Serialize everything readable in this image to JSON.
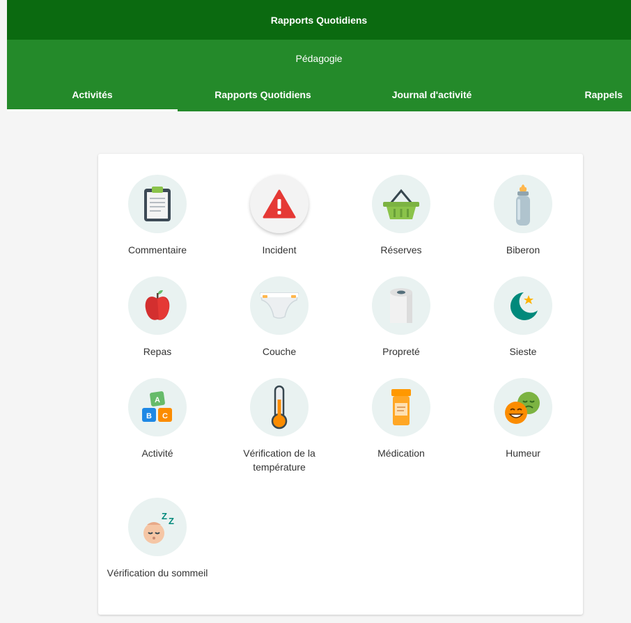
{
  "header": {
    "title": "Rapports Quotidiens"
  },
  "subheader": {
    "title": "Pédagogie"
  },
  "tabs": [
    {
      "label": "Activités",
      "active": true
    },
    {
      "label": "Rapports Quotidiens",
      "active": false
    },
    {
      "label": "Journal d'activité",
      "active": false
    },
    {
      "label": "Rappels",
      "active": false
    }
  ],
  "activities": [
    {
      "label": "Commentaire",
      "icon": "clipboard-icon"
    },
    {
      "label": "Incident",
      "icon": "warning-icon"
    },
    {
      "label": "Réserves",
      "icon": "basket-icon"
    },
    {
      "label": "Biberon",
      "icon": "baby-bottle-icon"
    },
    {
      "label": "Repas",
      "icon": "apple-icon"
    },
    {
      "label": "Couche",
      "icon": "diaper-icon"
    },
    {
      "label": "Propreté",
      "icon": "toilet-paper-icon"
    },
    {
      "label": "Sieste",
      "icon": "moon-star-icon"
    },
    {
      "label": "Activité",
      "icon": "abc-blocks-icon"
    },
    {
      "label": "Vérification de la température",
      "icon": "thermometer-icon"
    },
    {
      "label": "Médication",
      "icon": "pill-bottle-icon"
    },
    {
      "label": "Humeur",
      "icon": "mood-faces-icon"
    },
    {
      "label": "Vérification du sommeil",
      "icon": "sleeping-baby-icon"
    }
  ],
  "colors": {
    "header_dark": "#0b6a10",
    "header_green": "#248a2a",
    "icon_circle": "#e9f2f1"
  }
}
